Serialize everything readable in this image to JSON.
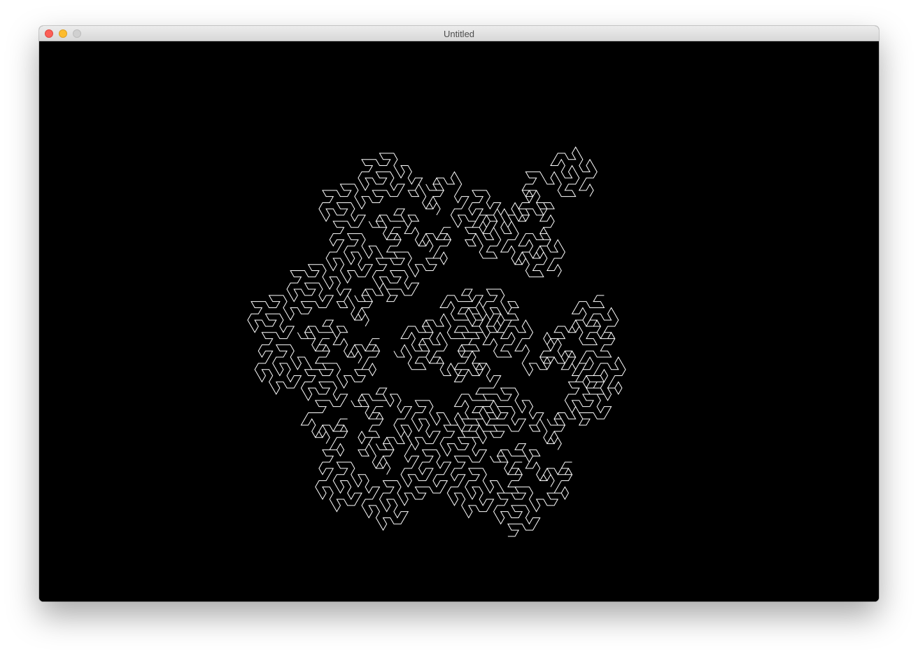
{
  "window": {
    "title": "Untitled",
    "background_color": "#000000",
    "stroke_color": "#ffffff"
  },
  "traffic_lights": {
    "close": "close-button",
    "minimize": "minimize-button",
    "zoom": "zoom-button"
  },
  "drawing": {
    "shape": "Gosper curve",
    "order": 4
  }
}
